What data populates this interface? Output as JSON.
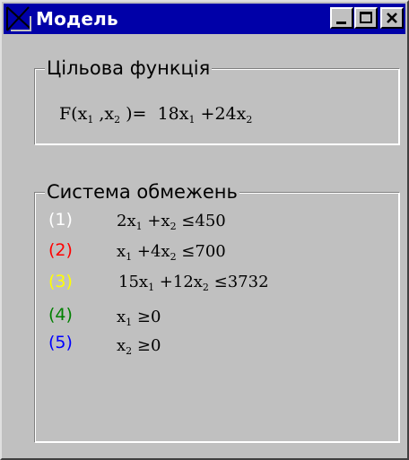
{
  "window": {
    "title": "Модель",
    "buttons": [
      "minimize",
      "maximize",
      "close"
    ]
  },
  "objective": {
    "group_label": "Цільова функція",
    "lhs": "F(x",
    "lhs_sub1": "1",
    "lhs_mid": " ,x",
    "lhs_sub2": "2",
    "lhs_end": " )=",
    "coef1": "18x",
    "sub1": "1",
    "op": " +24x",
    "sub2": "2"
  },
  "constraints": {
    "group_label": "Система обмежень",
    "items": [
      {
        "num": "(1)",
        "color": "#ffffff",
        "parts": [
          "2x",
          "1",
          " +x",
          "2",
          " ≤450"
        ]
      },
      {
        "num": "(2)",
        "color": "#ff0000",
        "parts": [
          "x",
          "1",
          " +4x",
          "2",
          " ≤700"
        ]
      },
      {
        "num": "(3)",
        "color": "#ffff00",
        "parts": [
          "15x",
          "1",
          " +12x",
          "2",
          " ≤3732"
        ]
      },
      {
        "num": "(4)",
        "color": "#008000",
        "parts": [
          "x",
          "1",
          " ≥0"
        ]
      },
      {
        "num": "(5)",
        "color": "#0000ff",
        "parts": [
          "x",
          "2",
          " ≥0"
        ]
      }
    ]
  }
}
